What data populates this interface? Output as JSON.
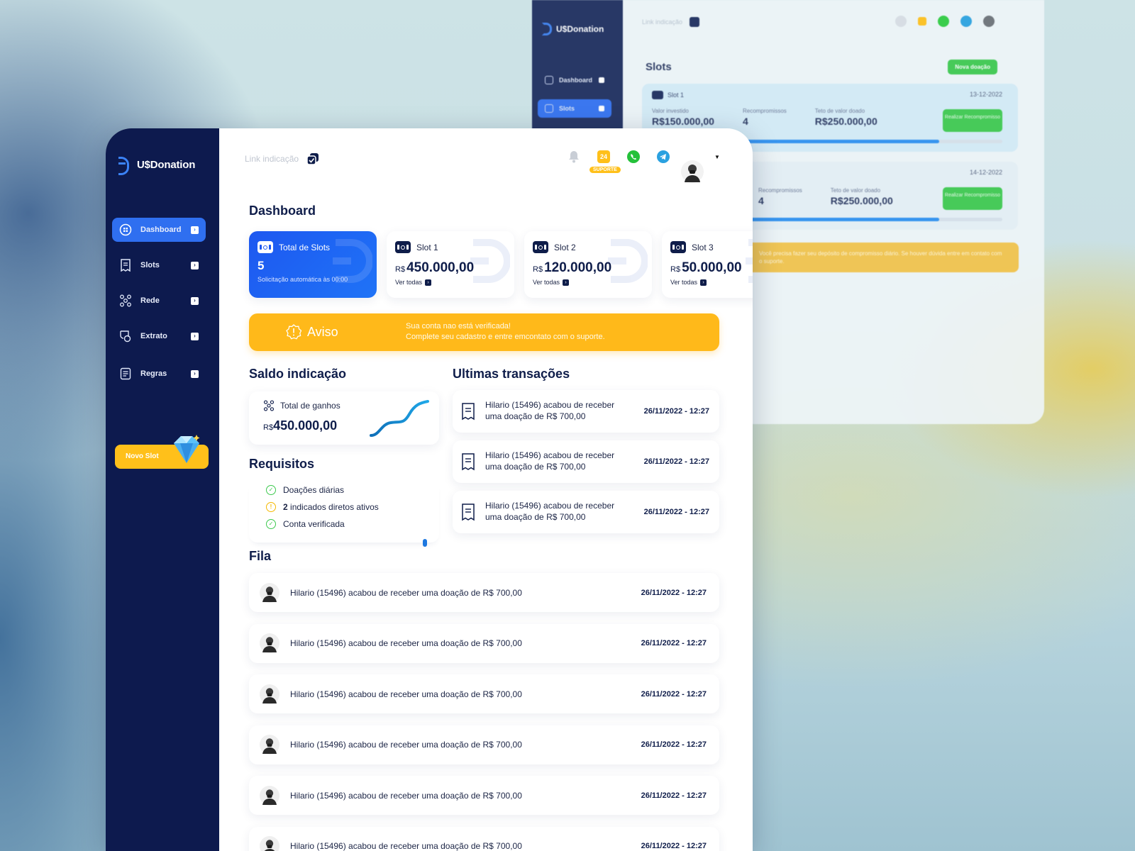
{
  "brand": {
    "name": "U$Donation",
    "accent": "#2f6ff0",
    "sidebar_bg": "#0d1a4e",
    "warning": "#ffb91a",
    "success": "#3cc94e"
  },
  "sidebar": {
    "items": [
      {
        "label": "Dashboard",
        "icon": "dashboard-icon",
        "active": true
      },
      {
        "label": "Slots",
        "icon": "receipt-icon",
        "active": false
      },
      {
        "label": "Rede",
        "icon": "network-icon",
        "active": false
      },
      {
        "label": "Extrato",
        "icon": "statement-icon",
        "active": false
      },
      {
        "label": "Regras",
        "icon": "rules-icon",
        "active": false
      }
    ],
    "novo_slot": "Novo Slot"
  },
  "header": {
    "link_indicacao": "Link indicação",
    "badge_count": "24",
    "suporte": "SUPORTE",
    "icons": [
      "bell-icon",
      "support-icon",
      "whatsapp-icon",
      "telegram-icon",
      "avatar"
    ]
  },
  "dashboard": {
    "title": "Dashboard",
    "cards": [
      {
        "title": "Total de Slots",
        "value": "5",
        "sub": "Solicitação automática às 00:00"
      },
      {
        "title": "Slot 1",
        "currency": "R$",
        "value": "450.000,00",
        "link": "Ver todas"
      },
      {
        "title": "Slot 2",
        "currency": "R$",
        "value": "120.000,00",
        "link": "Ver todas"
      },
      {
        "title": "Slot 3",
        "currency": "R$",
        "value": "50.000,00",
        "link": "Ver todas"
      }
    ]
  },
  "aviso": {
    "title": "Aviso",
    "line1": "Sua conta nao está verificada!",
    "line2": "Complete seu cadastro e entre emcontato com o suporte."
  },
  "saldo": {
    "title": "Saldo indicação",
    "label": "Total de ganhos",
    "currency": "R$",
    "value": "450.000,00"
  },
  "requisitos": {
    "title": "Requisitos",
    "items": [
      {
        "status": "ok",
        "bold": "",
        "text": "Doações diárias"
      },
      {
        "status": "warn",
        "bold": "2",
        "text": " indicados diretos ativos"
      },
      {
        "status": "ok",
        "bold": "",
        "text": "Conta verificada"
      }
    ]
  },
  "transacoes": {
    "title": "Ultimas transações",
    "items": [
      {
        "text": "Hilario (15496) acabou de receber uma doação de R$ 700,00",
        "date": "26/11/2022 - 12:27"
      },
      {
        "text": "Hilario (15496) acabou de receber uma doação de R$ 700,00",
        "date": "26/11/2022 - 12:27"
      },
      {
        "text": "Hilario (15496) acabou de receber uma doação de R$ 700,00",
        "date": "26/11/2022 - 12:27"
      }
    ]
  },
  "fila": {
    "title": "Fila",
    "items": [
      {
        "text": "Hilario (15496) acabou de receber uma doação de R$ 700,00",
        "date": "26/11/2022 - 12:27"
      },
      {
        "text": "Hilario (15496) acabou de receber uma doação de R$ 700,00",
        "date": "26/11/2022 - 12:27"
      },
      {
        "text": "Hilario (15496) acabou de receber uma doação de R$ 700,00",
        "date": "26/11/2022 - 12:27"
      },
      {
        "text": "Hilario (15496) acabou de receber uma doação de R$ 700,00",
        "date": "26/11/2022 - 12:27"
      },
      {
        "text": "Hilario (15496) acabou de receber uma doação de R$ 700,00",
        "date": "26/11/2022 - 12:27"
      },
      {
        "text": "Hilario (15496) acabou de receber uma doação de R$ 700,00",
        "date": "26/11/2022 - 12:27"
      }
    ]
  },
  "back_window": {
    "brand": "U$Donation",
    "nav": [
      "Dashboard",
      "Slots"
    ],
    "link_indicacao": "Link indicação",
    "title": "Slots",
    "new_button": "Nova doação",
    "slots": [
      {
        "name": "Slot 1",
        "date": "13-12-2022",
        "invested_label": "Valor investido",
        "invested": "R$150.000,00",
        "commit_label": "Recompromissos",
        "commit": "4",
        "cap_label": "Teto de valor doado",
        "cap": "R$250.000,00",
        "button": "Realizar Recompromisso",
        "progress": 0.82
      },
      {
        "name": "",
        "date": "14-12-2022",
        "invested_label": "",
        "invested": "",
        "commit_label": "Recompromissos",
        "commit": "4",
        "cap_label": "Teto de valor doado",
        "cap": "R$250.000,00",
        "button": "Realizar Recompromisso",
        "progress": 0.82
      }
    ],
    "warning": "Você precisa fazer seu depósito de compromisso diário. Se houver dúvida entre em contato com o suporte."
  }
}
